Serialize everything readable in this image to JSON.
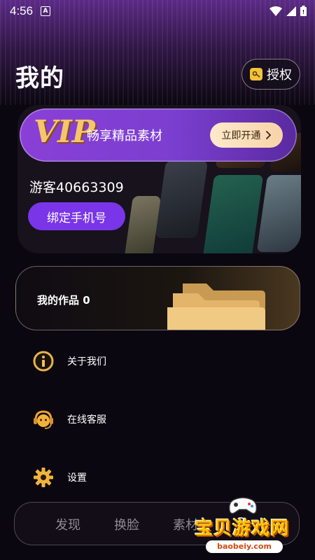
{
  "status_bar": {
    "time": "4:56",
    "notif_letter": "A"
  },
  "header": {
    "title": "我的",
    "auth_label": "授权"
  },
  "vip": {
    "badge": "VIP",
    "tagline": "畅享精品素材",
    "open_label": "立即开通"
  },
  "profile": {
    "guest_name": "游客40663309",
    "bind_label": "绑定手机号"
  },
  "works": {
    "label": "我的作品 0"
  },
  "menu": [
    {
      "label": "关于我们",
      "icon": "info-icon"
    },
    {
      "label": "在线客服",
      "icon": "headset-icon"
    },
    {
      "label": "设置",
      "icon": "gear-icon"
    }
  ],
  "bottom_nav": {
    "tabs": [
      "发现",
      "换脸",
      "素材"
    ],
    "partial_tab": "3"
  },
  "watermark": {
    "text": "宝贝游戏网",
    "url": "baobeiy.com"
  },
  "colors": {
    "accent": "#7a35e8",
    "gold": "#f5c66a",
    "background": "#0b0710"
  }
}
